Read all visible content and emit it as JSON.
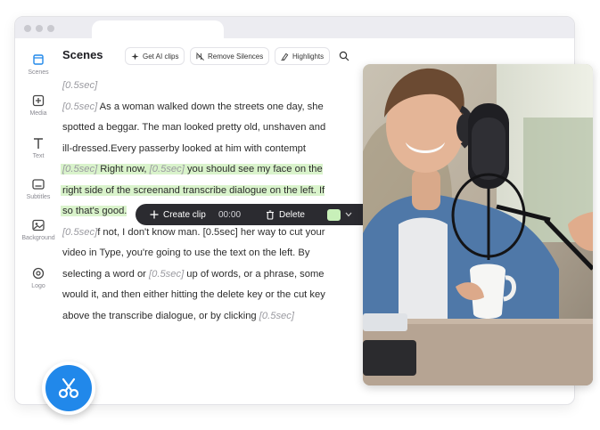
{
  "sidebar": {
    "items": [
      {
        "label": "Scenes",
        "icon": "scenes-icon",
        "active": true
      },
      {
        "label": "Media",
        "icon": "media-icon"
      },
      {
        "label": "Text",
        "icon": "text-icon"
      },
      {
        "label": "Subtitles",
        "icon": "subtitles-icon"
      },
      {
        "label": "Background",
        "icon": "background-icon"
      },
      {
        "label": "Logo",
        "icon": "logo-icon"
      }
    ]
  },
  "header": {
    "title": "Scenes",
    "buttons": [
      {
        "label": "Get AI clips",
        "icon": "sparkle-icon"
      },
      {
        "label": "Remove Silences",
        "icon": "remove-silence-icon"
      },
      {
        "label": "Highlights",
        "icon": "highlight-pen-icon"
      }
    ]
  },
  "transcript": {
    "lines": [
      [
        {
          "t": "[0.5sec]",
          "tag": true
        }
      ],
      [
        {
          "t": "[0.5sec]",
          "tag": true
        },
        {
          "t": " As a woman walked down the streets one day, she"
        }
      ],
      [
        {
          "t": "spotted a beggar. The man looked pretty old, unshaven and"
        }
      ],
      [
        {
          "t": "ill-dressed.Every passerby looked at him with contempt"
        }
      ],
      [
        {
          "t": "[0.5sec]",
          "tag": true
        },
        {
          "t": " Right now, "
        },
        {
          "t": " [0.5sec]",
          "tag": true
        },
        {
          "t": " you should see my face on the"
        }
      ],
      [
        {
          "t": "right side of the screenand transcribe dialogue on the left. If"
        }
      ],
      [
        {
          "t": "so that's good."
        }
      ],
      [
        {
          "t": "[0.5sec]",
          "tag": true
        },
        {
          "t": "f not, I don't know man. [0.5sec] her way to cut your"
        }
      ],
      [
        {
          "t": "video in Type, you're going to use the text on the left. By"
        }
      ],
      [
        {
          "t": "selecting a word or "
        },
        {
          "t": " [0.5sec]",
          "tag": true
        },
        {
          "t": " up of words, or a phrase, some"
        }
      ],
      [
        {
          "t": "would it, and then either hitting the delete key or the cut key"
        }
      ],
      [
        {
          "t": "above the transcribe dialogue, or by clicking "
        },
        {
          "t": "[0.5sec]",
          "tag": true
        }
      ]
    ],
    "highlighted_lines": [
      4,
      5,
      6
    ]
  },
  "clip_toolbar": {
    "create_label": "Create clip",
    "time": "00:00",
    "delete_label": "Delete",
    "swatch_color": "#c8f0b9"
  },
  "colors": {
    "accent": "#2188ea",
    "highlight": "#d9f3cb",
    "toolbar_bg": "#2b2b30"
  }
}
